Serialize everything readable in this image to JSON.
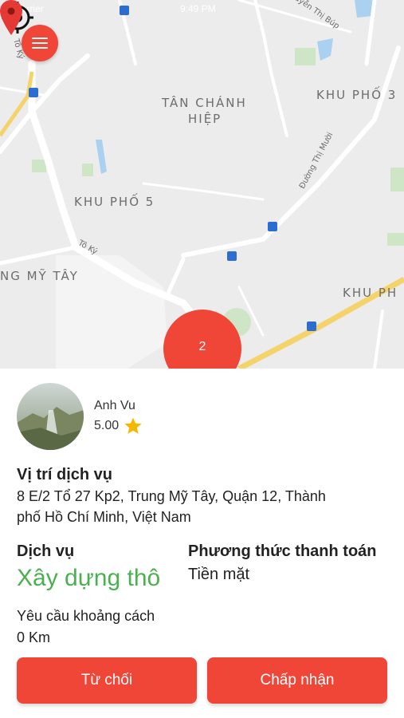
{
  "status_bar": {
    "carrier": "Carrier",
    "time": "9:49 PM"
  },
  "map": {
    "area_labels": [
      "TÂN CHÁNH",
      "HIỆP",
      "KHU PHỐ 3",
      "KHU PHỐ 5",
      "NG MỸ TÂY",
      "KHU PH"
    ],
    "street_labels": [
      "Nguyễn Thị Búp",
      "Đường Thị Mười",
      "Tô Ký",
      "Tô Ký"
    ],
    "cluster_count": "2"
  },
  "driver": {
    "name": "Anh Vu",
    "rating": "5.00"
  },
  "location": {
    "title": "Vị trí dịch vụ",
    "address_line1": "8 E/2 Tổ 27 Kp2, Trung Mỹ Tây, Quận 12, Thành",
    "address_line2": "phố Hồ Chí Minh, Việt Nam"
  },
  "service": {
    "title": "Dịch vụ",
    "value": "Xây dựng thô"
  },
  "payment": {
    "title": "Phương thức thanh toán",
    "value": "Tiền mặt"
  },
  "distance": {
    "label": "Yêu cầu khoảng cách",
    "value": "0 Km"
  },
  "actions": {
    "reject": "Từ chối",
    "accept": "Chấp nhận"
  },
  "colors": {
    "accent": "#ef4638",
    "service": "#4caf50",
    "star": "#f5b800",
    "map_bg": "#ececec",
    "road_yellow": "#f4d36b"
  }
}
